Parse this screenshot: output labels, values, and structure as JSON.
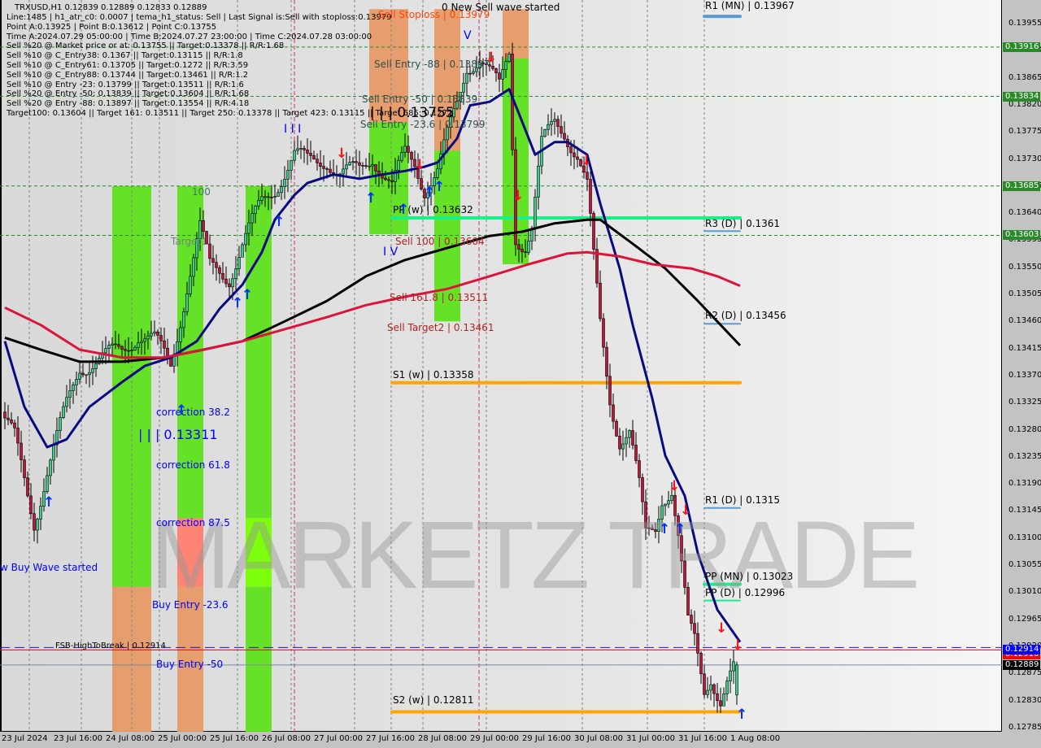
{
  "header": {
    "title": "TRXUSD,H1  0.12839 0.12889 0.12833 0.12889",
    "lines": [
      "Line:1485 | h1_atr_c0: 0.0007 | tema_h1_status: Sell | Last Signal is:Sell with stoploss:0.13979",
      "Point A:0.13925 | Point B:0.13612 | Point C:0.13755",
      "Time A:2024.07.29 05:00:00 | Time B:2024.07.27 23:00:00 | Time C:2024.07.28 03:00:00",
      "Sell %20 @ Market price or at: 0.13755 || Target:0.13378 || R/R:1.68",
      "Sell %10 @ C_Entry38: 0.1367 || Target:0.13115 || R/R:1.8",
      "Sell %10 @ C_Entry61: 0.13705 || Target:0.1272 || R/R:3.59",
      "Sell %10 @ C_Entry88: 0.13744 || Target:0.13461 || R/R:1.2",
      "Sell %10 @ Entry -23: 0.13799 || Target:0.13511 || R/R:1.6",
      "Sell %20 @ Entry -50: 0.13839 || Target:0.13604 || R/R:1.68",
      "Sell %20 @ Entry -88: 0.13897 || Target:0.13554 || R/R:4.18",
      "Target100: 0.13604 || Target 161: 0.13511 || Target 250: 0.13378 || Target 423: 0.13115 || Target 685: 0.1272"
    ]
  },
  "labels": {
    "sell_stoploss": "Sell Stoploss | 0.13979",
    "new_sell_wave": "0 New Sell wave started",
    "sell_entry_88": "Sell Entry -88 | 0.13897",
    "sell_entry_50": "Sell Entry -50 | 0.13839",
    "point_c": "| | | 0.13755",
    "sell_entry_23": "Sell Entry -23.6 | 0.13799",
    "pp_w": "PP (w) | 0.13632",
    "sell_100": "Sell 100 | 0.13604",
    "sell_161": "Sell 161.8 | 0.13511",
    "sell_target2": "Sell Target2 | 0.13461",
    "s1_w": "S1 (w) | 0.13358",
    "s2_w": "S2 (w) | 0.12811",
    "wave_iv": "I V",
    "wave_v": "V",
    "wave_iii": "I I I",
    "l100": "100",
    "target1": "Target1",
    "correction_38": "correction 38.2",
    "point_311": "| | | 0.13311",
    "correction_61": "correction 61.8",
    "correction_87": "correction 87.5",
    "buy_entry_23": "Buy Entry -23.6",
    "buy_entry_50": "Buy Entry -50",
    "buy_wave": "w Buy Wave started",
    "fsb": "FSB-HighToBreak | 0.12914",
    "r1_mn": "R1 (MN) | 0.13967",
    "r3_d": "R3 (D) | 0.1361",
    "r2_d": "R2 (D) | 0.13456",
    "r1_d": "R1 (D) | 0.1315",
    "pp_mn": "PP (MN) | 0.13023",
    "pp_d": "PP (D) | 0.12996",
    "watermark": "MARKETZ TRADE"
  },
  "colors": {
    "bull": "#3ad08c",
    "bear": "#c4143c",
    "navy_ma": "#0a0a80",
    "black_ma": "#000000",
    "red_ma": "#dc143c",
    "zone_green": "#5ee01c",
    "zone_orange": "#e69a68",
    "zone_salmon": "#ff8070",
    "zone_lime": "#77ff00",
    "pivot_green": "#19f08a",
    "support_orange": "#ffa500",
    "pivot_blue": "#5b9bd5",
    "grid_green": "#2a8a2a"
  },
  "chart_data": {
    "type": "candlestick",
    "title": "TRXUSD,H1",
    "ylim": [
      0.1277,
      0.1399
    ],
    "y_ticks": [
      "0.13955",
      "0.13910",
      "0.13865",
      "0.13820",
      "0.13775",
      "0.13730",
      "0.13685",
      "0.13640",
      "0.13595",
      "0.13550",
      "0.13505",
      "0.13460",
      "0.13415",
      "0.13370",
      "0.13325",
      "0.13280",
      "0.13235",
      "0.13190",
      "0.13145",
      "0.13100",
      "0.13055",
      "0.13010",
      "0.12965",
      "0.12920",
      "0.12875",
      "0.12830",
      "0.12785"
    ],
    "x_ticks": [
      "23 Jul 2024",
      "23 Jul 16:00",
      "24 Jul 08:00",
      "25 Jul 00:00",
      "25 Jul 16:00",
      "26 Jul 08:00",
      "27 Jul 00:00",
      "27 Jul 16:00",
      "28 Jul 08:00",
      "29 Jul 00:00",
      "29 Jul 16:00",
      "30 Jul 08:00",
      "31 Jul 00:00",
      "31 Jul 16:00",
      "1 Aug 08:00"
    ],
    "close_path": [
      [
        "07-23 01:00",
        0.13292
      ],
      [
        "07-23 04:00",
        0.13265
      ],
      [
        "07-23 10:00",
        0.13129
      ],
      [
        "07-23 14:00",
        0.1321
      ],
      [
        "07-23 20:00",
        0.13319
      ],
      [
        "07-24 00:00",
        0.13386
      ],
      [
        "07-24 08:00",
        0.134
      ],
      [
        "07-24 13:00",
        0.13413
      ],
      [
        "07-24 18:00",
        0.1344
      ],
      [
        "07-24 23:00",
        0.13427
      ],
      [
        "07-25 04:00",
        0.13386
      ],
      [
        "07-25 09:00",
        0.13521
      ],
      [
        "07-25 13:00",
        0.13616
      ],
      [
        "07-25 16:00",
        0.13548
      ],
      [
        "07-25 22:00",
        0.13535
      ],
      [
        "07-26 02:00",
        0.13589
      ],
      [
        "07-26 08:00",
        0.13656
      ],
      [
        "07-26 12:00",
        0.13683
      ],
      [
        "07-26 18:00",
        0.13737
      ],
      [
        "07-26 22:00",
        0.13724
      ],
      [
        "07-27 04:00",
        0.13731
      ],
      [
        "07-27 08:00",
        0.13704
      ],
      [
        "07-27 14:00",
        0.1371
      ],
      [
        "07-27 18:00",
        0.13737
      ],
      [
        "07-28 00:00",
        0.13683
      ],
      [
        "07-28 04:00",
        0.13737
      ],
      [
        "07-28 07:00",
        0.13724
      ],
      [
        "07-28 10:00",
        0.13683
      ],
      [
        "07-28 14:00",
        0.1371
      ],
      [
        "07-28 20:00",
        0.13819
      ],
      [
        "07-28 23:00",
        0.13886
      ],
      [
        "07-29 03:00",
        0.139
      ],
      [
        "07-29 06:00",
        0.13873
      ],
      [
        "07-29 09:00",
        0.13846
      ],
      [
        "07-29 12:00",
        0.13906
      ],
      [
        "07-29 14:00",
        0.13602
      ],
      [
        "07-29 17:00",
        0.13589
      ],
      [
        "07-29 19:00",
        0.13616
      ],
      [
        "07-29 22:00",
        0.13751
      ],
      [
        "07-30 02:00",
        0.13791
      ],
      [
        "07-30 05:00",
        0.13778
      ],
      [
        "07-30 09:00",
        0.13737
      ],
      [
        "07-30 12:00",
        0.13683
      ],
      [
        "07-30 14:00",
        0.13562
      ],
      [
        "07-30 16:00",
        0.13454
      ],
      [
        "07-30 19:00",
        0.13332
      ],
      [
        "07-30 22:00",
        0.13265
      ],
      [
        "07-31 01:00",
        0.13278
      ],
      [
        "07-31 04:00",
        0.13183
      ],
      [
        "07-31 06:00",
        0.13102
      ],
      [
        "07-31 09:00",
        0.13116
      ],
      [
        "07-31 11:00",
        0.1317
      ],
      [
        "07-31 14:00",
        0.13183
      ],
      [
        "07-31 16:00",
        0.13102
      ],
      [
        "07-31 19:00",
        0.12954
      ],
      [
        "07-31 21:00",
        0.12927
      ],
      [
        "08-01 00:00",
        0.12846
      ],
      [
        "08-01 02:00",
        0.12873
      ],
      [
        "08-01 05:00",
        0.12832
      ],
      [
        "08-01 07:00",
        0.12859
      ],
      [
        "08-01 10:00",
        0.12889
      ]
    ],
    "last_ohlc": {
      "open": 0.12839,
      "high": 0.12889,
      "low": 0.12833,
      "close": 0.12889
    },
    "moving_averages": [
      {
        "color_key": "navy_ma",
        "points": [
          [
            "07-23 01:00",
            0.13427
          ],
          [
            "07-23 07:00",
            0.13318
          ],
          [
            "07-23 14:00",
            0.13251
          ],
          [
            "07-23 20:00",
            0.13264
          ],
          [
            "07-24 03:00",
            0.13318
          ],
          [
            "07-24 13:00",
            0.13359
          ],
          [
            "07-24 20:00",
            0.13386
          ],
          [
            "07-25 04:00",
            0.134
          ],
          [
            "07-25 12:00",
            0.13427
          ],
          [
            "07-25 19:00",
            0.13481
          ],
          [
            "07-26 02:00",
            0.13521
          ],
          [
            "07-26 08:00",
            0.13575
          ],
          [
            "07-26 12:00",
            0.13629
          ],
          [
            "07-26 18:00",
            0.1367
          ],
          [
            "07-26 22:00",
            0.1369
          ],
          [
            "07-27 06:00",
            0.13704
          ],
          [
            "07-27 14:00",
            0.13697
          ],
          [
            "07-27 21:00",
            0.13704
          ],
          [
            "07-28 04:00",
            0.1371
          ],
          [
            "07-28 10:00",
            0.13717
          ],
          [
            "07-28 14:00",
            0.13724
          ],
          [
            "07-28 20:00",
            0.13764
          ],
          [
            "07-29 00:00",
            0.13819
          ],
          [
            "07-29 06:00",
            0.13825
          ],
          [
            "07-29 12:00",
            0.13846
          ],
          [
            "07-29 16:00",
            0.13792
          ],
          [
            "07-29 20:00",
            0.13737
          ],
          [
            "07-30 02:00",
            0.13758
          ],
          [
            "07-30 06:00",
            0.13758
          ],
          [
            "07-30 12:00",
            0.13737
          ],
          [
            "07-30 16:00",
            0.13656
          ],
          [
            "07-30 22:00",
            0.13548
          ],
          [
            "07-31 02:00",
            0.13454
          ],
          [
            "07-31 08:00",
            0.13332
          ],
          [
            "07-31 12:00",
            0.13237
          ],
          [
            "07-31 18:00",
            0.1317
          ],
          [
            "07-31 22:00",
            0.13075
          ],
          [
            "08-01 04:00",
            0.12981
          ],
          [
            "08-01 11:00",
            0.12927
          ]
        ]
      },
      {
        "color_key": "black_ma",
        "points": [
          [
            "07-23 01:00",
            0.13433
          ],
          [
            "07-23 12:00",
            0.13413
          ],
          [
            "07-24 00:00",
            0.13393
          ],
          [
            "07-24 13:00",
            0.13393
          ],
          [
            "07-25 02:00",
            0.134
          ],
          [
            "07-25 14:00",
            0.13413
          ],
          [
            "07-26 02:00",
            0.13427
          ],
          [
            "07-26 15:00",
            0.1346
          ],
          [
            "07-27 04:00",
            0.13494
          ],
          [
            "07-27 16:00",
            0.13535
          ],
          [
            "07-28 04:00",
            0.13562
          ],
          [
            "07-28 17:00",
            0.13582
          ],
          [
            "07-29 06:00",
            0.13602
          ],
          [
            "07-29 16:00",
            0.13609
          ],
          [
            "07-30 02:00",
            0.13623
          ],
          [
            "07-30 12:00",
            0.13629
          ],
          [
            "07-30 16:00",
            0.13629
          ],
          [
            "07-31 02:00",
            0.13589
          ],
          [
            "07-31 12:00",
            0.13548
          ],
          [
            "07-31 22:00",
            0.13494
          ],
          [
            "08-01 11:00",
            0.1342
          ]
        ]
      },
      {
        "color_key": "red_ma",
        "points": [
          [
            "07-23 01:00",
            0.13483
          ],
          [
            "07-23 12:00",
            0.13454
          ],
          [
            "07-24 00:00",
            0.13413
          ],
          [
            "07-24 13:00",
            0.134
          ],
          [
            "07-25 02:00",
            0.134
          ],
          [
            "07-25 14:00",
            0.13413
          ],
          [
            "07-26 02:00",
            0.13427
          ],
          [
            "07-26 15:00",
            0.13447
          ],
          [
            "07-27 04:00",
            0.13467
          ],
          [
            "07-27 16:00",
            0.13487
          ],
          [
            "07-28 04:00",
            0.13501
          ],
          [
            "07-28 17:00",
            0.13514
          ],
          [
            "07-29 06:00",
            0.13535
          ],
          [
            "07-29 18:00",
            0.13555
          ],
          [
            "07-30 06:00",
            0.13573
          ],
          [
            "07-30 12:00",
            0.13575
          ],
          [
            "07-30 22:00",
            0.13568
          ],
          [
            "07-31 08:00",
            0.13555
          ],
          [
            "07-31 20:00",
            0.13548
          ],
          [
            "08-01 04:00",
            0.13535
          ],
          [
            "08-01 11:00",
            0.13519
          ]
        ]
      }
    ],
    "zones": [
      {
        "from": "07-24 10:00",
        "to": "07-24 22:00",
        "bands": [
          [
            "zone_orange",
            0.1277,
            0.13019
          ],
          [
            "zone_green",
            0.13019,
            0.13685
          ]
        ]
      },
      {
        "from": "07-25 06:00",
        "to": "07-25 14:00",
        "bands": [
          [
            "zone_orange",
            0.1277,
            0.13019
          ],
          [
            "zone_salmon",
            0.13019,
            0.13133
          ],
          [
            "zone_green",
            0.13133,
            0.13685
          ]
        ]
      },
      {
        "from": "07-26 03:00",
        "to": "07-26 11:00",
        "bands": [
          [
            "zone_green",
            0.1277,
            0.13019
          ],
          [
            "zone_lime",
            0.13019,
            0.13133
          ],
          [
            "zone_green",
            0.13133,
            0.13685
          ]
        ]
      },
      {
        "from": "07-27 17:00",
        "to": "07-28 05:00",
        "bands": [
          [
            "zone_green",
            0.13605,
            0.13791
          ],
          [
            "zone_orange",
            0.13791,
            0.13979
          ]
        ]
      },
      {
        "from": "07-28 13:00",
        "to": "07-28 21:00",
        "bands": [
          [
            "zone_green",
            0.1346,
            0.13744
          ],
          [
            "zone_orange",
            0.13744,
            0.13979
          ]
        ]
      },
      {
        "from": "07-29 10:00",
        "to": "07-29 18:00",
        "bands": [
          [
            "zone_green",
            0.13555,
            0.13897
          ],
          [
            "zone_orange",
            0.13897,
            0.13979
          ]
        ]
      }
    ],
    "grid_levels": [
      0.13916,
      0.13834,
      0.13685,
      0.13603
    ],
    "levels": [
      {
        "name": "PP (w)",
        "price": 0.13632,
        "from": "07-28 00:00",
        "to": "08-01 11:00",
        "color_key": "pivot_green",
        "width": 4
      },
      {
        "name": "S1 (w)",
        "price": 0.13358,
        "from": "07-28 00:00",
        "to": "08-01 11:00",
        "color_key": "support_orange",
        "width": 4
      },
      {
        "name": "S2 (w)",
        "price": 0.12811,
        "from": "07-28 00:00",
        "to": "08-01 11:00",
        "color_key": "support_orange",
        "width": 4
      },
      {
        "name": "R1 (MN)",
        "price": 0.13967,
        "from": "08-01 00:00",
        "to": "08-01 11:00",
        "color_key": "pivot_blue",
        "width": 4
      },
      {
        "name": "R3 (D)",
        "price": 0.1361,
        "from": "08-01 00:00",
        "to": "08-01 11:00",
        "color_key": "pivot_blue",
        "width": 2
      },
      {
        "name": "R2 (D)",
        "price": 0.13456,
        "from": "08-01 00:00",
        "to": "08-01 11:00",
        "color_key": "pivot_blue",
        "width": 2
      },
      {
        "name": "R1 (D)",
        "price": 0.1315,
        "from": "08-01 00:00",
        "to": "08-01 11:00",
        "color_key": "pivot_blue",
        "width": 2
      },
      {
        "name": "PP (MN)",
        "price": 0.13023,
        "from": "08-01 00:00",
        "to": "08-01 11:00",
        "color_key": "pivot_green",
        "width": 4
      },
      {
        "name": "PP (D)",
        "price": 0.12996,
        "from": "08-01 00:00",
        "to": "08-01 11:00",
        "color_key": "pivot_green",
        "width": 2
      }
    ],
    "full_lines": [
      {
        "name": "FSB-HighToBreak",
        "price": 0.12914,
        "color": "#ff0000",
        "dash": false
      },
      {
        "name": "stoploss-dash",
        "price": 0.12918,
        "color": "#1a1ad0",
        "dash": true
      },
      {
        "name": "bid",
        "price": 0.12889,
        "color": "#7a8aa0",
        "dash": false
      }
    ],
    "price_badges": [
      {
        "value": "0.13916",
        "color": "#2a8a2a"
      },
      {
        "value": "0.13834",
        "color": "#2a8a2a"
      },
      {
        "value": "0.13685",
        "color": "#2a8a2a"
      },
      {
        "value": "0.13603",
        "color": "#2a8a2a"
      },
      {
        "value": "0.12910",
        "color": "#ff0000"
      },
      {
        "value": "0.12914",
        "color": "#0000ff"
      },
      {
        "value": "0.12889",
        "color": "#000000"
      }
    ]
  }
}
